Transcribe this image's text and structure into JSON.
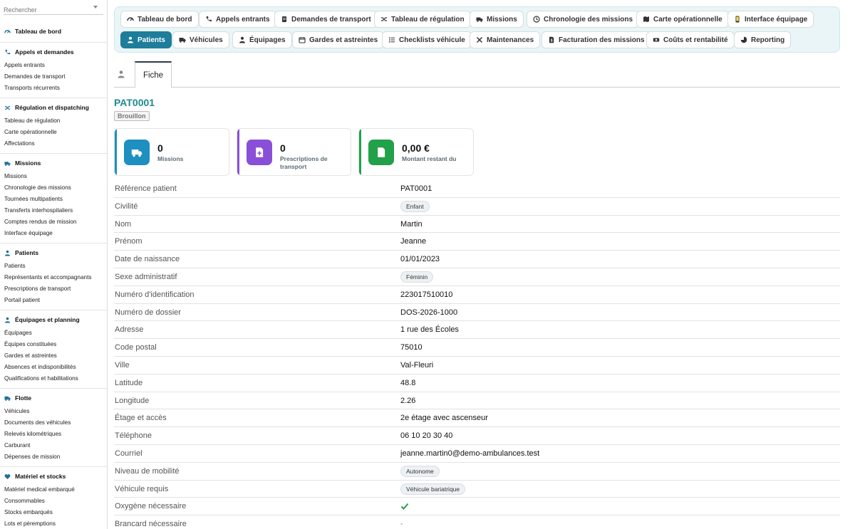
{
  "search": {
    "placeholder": "Rechercher"
  },
  "sidebar": {
    "groups": [
      {
        "title": "Tableau de bord",
        "icon": "dashboard-icon",
        "items": []
      },
      {
        "title": "Appels et demandes",
        "icon": "phone-icon",
        "items": [
          "Appels entrants",
          "Demandes de transport",
          "Transports récurrents"
        ]
      },
      {
        "title": "Régulation et dispatching",
        "icon": "shuffle-icon",
        "items": [
          "Tableau de régulation",
          "Carte opérationnelle",
          "Affectations"
        ]
      },
      {
        "title": "Missions",
        "icon": "ambulance-icon",
        "items": [
          "Missions",
          "Chronologie des missions",
          "Tournées multipatients",
          "Transferts interhospitaliers",
          "Comptes rendus de mission",
          "Interface équipage"
        ]
      },
      {
        "title": "Patients",
        "icon": "patient-icon",
        "items": [
          "Patients",
          "Représentants et accompagnants",
          "Prescriptions de transport",
          "Portail patient"
        ]
      },
      {
        "title": "Équipages et planning",
        "icon": "crew-icon",
        "items": [
          "Équipages",
          "Équipes constituées",
          "Gardes et astreintes",
          "Absences et indisponibilités",
          "Qualifications et habilitations"
        ]
      },
      {
        "title": "Flotte",
        "icon": "truck-icon",
        "items": [
          "Véhicules",
          "Documents des véhicules",
          "Relevés kilométriques",
          "Carburant",
          "Dépenses de mission"
        ]
      },
      {
        "title": "Matériel et stocks",
        "icon": "heart-icon",
        "items": [
          "Matériel medical embarqué",
          "Consommables",
          "Stocks embarqués",
          "Lots et péremptions"
        ]
      }
    ]
  },
  "tabs": {
    "row1": [
      {
        "label": "Tableau de bord",
        "icon": "dashboard-icon"
      },
      {
        "label": "Appels entrants",
        "icon": "phone-icon"
      },
      {
        "label": "Demandes de transport",
        "icon": "document-icon"
      },
      {
        "label": "Tableau de régulation",
        "icon": "shuffle-icon"
      },
      {
        "label": "Missions",
        "icon": "ambulance-icon"
      },
      {
        "label": "Chronologie des missions",
        "icon": "timeline-icon"
      },
      {
        "label": "Carte opérationnelle",
        "icon": "map-icon"
      },
      {
        "label": "Interface équipage",
        "icon": "mobile-icon"
      }
    ],
    "row2": [
      {
        "label": "Patients",
        "icon": "patient-icon",
        "active": true
      },
      {
        "label": "Véhicules",
        "icon": "truck-icon"
      },
      {
        "label": "Équipages",
        "icon": "crew-icon"
      },
      {
        "label": "Gardes et astreintes",
        "icon": "calendar-icon"
      },
      {
        "label": "Checklists véhicule",
        "icon": "list-icon"
      },
      {
        "label": "Maintenances",
        "icon": "tools-icon"
      },
      {
        "label": "Facturation des missions",
        "icon": "invoice-icon"
      },
      {
        "label": "Coûts et rentabilité",
        "icon": "money-icon"
      },
      {
        "label": "Reporting",
        "icon": "chart-icon"
      }
    ]
  },
  "subtab": {
    "label": "Fiche"
  },
  "record": {
    "id": "PAT0001",
    "status": "Brouillon"
  },
  "cards": [
    {
      "value": "0",
      "label": "Missions",
      "color": "#1d8fc0",
      "icon": "ambulance-icon"
    },
    {
      "value": "0",
      "label": "Prescriptions de transport",
      "color": "#8a4fd8",
      "icon": "prescription-icon"
    },
    {
      "value": "0,00 €",
      "label": "Montant restant du",
      "color": "#23a04a",
      "icon": "invoice-icon"
    }
  ],
  "fields": [
    {
      "label": "Référence patient",
      "value": "PAT0001",
      "type": "text"
    },
    {
      "label": "Civilité",
      "value": "Enfant",
      "type": "pill"
    },
    {
      "label": "Nom",
      "value": "Martin",
      "type": "text"
    },
    {
      "label": "Prénom",
      "value": "Jeanne",
      "type": "text"
    },
    {
      "label": "Date de naissance",
      "value": "01/01/2023",
      "type": "text"
    },
    {
      "label": "Sexe administratif",
      "value": "Féminin",
      "type": "pill"
    },
    {
      "label": "Numéro d'identification",
      "value": "223017510010",
      "type": "text"
    },
    {
      "label": "Numéro de dossier",
      "value": "DOS-2026-1000",
      "type": "text"
    },
    {
      "label": "Adresse",
      "value": "1 rue des Écoles",
      "type": "text"
    },
    {
      "label": "Code postal",
      "value": "75010",
      "type": "text"
    },
    {
      "label": "Ville",
      "value": "Val-Fleuri",
      "type": "text"
    },
    {
      "label": "Latitude",
      "value": "48.8",
      "type": "text"
    },
    {
      "label": "Longitude",
      "value": "2.26",
      "type": "text"
    },
    {
      "label": "Étage et accès",
      "value": "2e étage avec ascenseur",
      "type": "text"
    },
    {
      "label": "Téléphone",
      "value": "06 10 20 30 40",
      "type": "text"
    },
    {
      "label": "Courriel",
      "value": "jeanne.martin0@demo-ambulances.test",
      "type": "text"
    },
    {
      "label": "Niveau de mobilité",
      "value": "Autonome",
      "type": "pill"
    },
    {
      "label": "Véhicule requis",
      "value": "Véhicule bariatrique",
      "type": "pill"
    },
    {
      "label": "Oxygène nécessaire",
      "value": "",
      "type": "check"
    },
    {
      "label": "Brancard nécessaire",
      "value": "-",
      "type": "dash"
    }
  ],
  "colors": {
    "accent": "#1d7d9a",
    "id": "#1e8a8f",
    "check": "#23a04a"
  }
}
